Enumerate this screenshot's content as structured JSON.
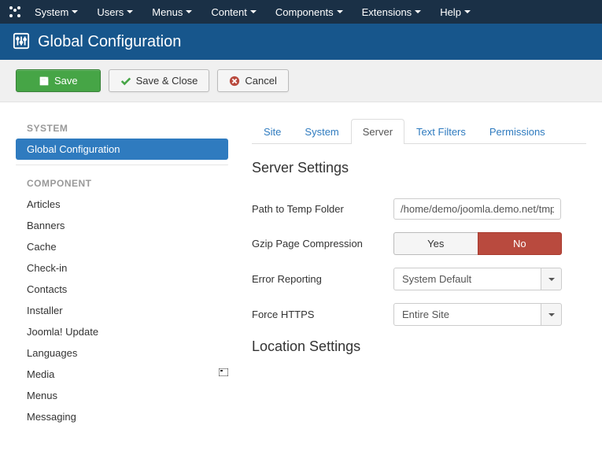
{
  "topnav": {
    "items": [
      "System",
      "Users",
      "Menus",
      "Content",
      "Components",
      "Extensions",
      "Help"
    ]
  },
  "header": {
    "title": "Global Configuration"
  },
  "toolbar": {
    "save": "Save",
    "save_close": "Save & Close",
    "cancel": "Cancel"
  },
  "sidebar": {
    "system_heading": "SYSTEM",
    "system_items": [
      "Global Configuration"
    ],
    "component_heading": "COMPONENT",
    "component_items": [
      "Articles",
      "Banners",
      "Cache",
      "Check-in",
      "Contacts",
      "Installer",
      "Joomla! Update",
      "Languages",
      "Media",
      "Menus",
      "Messaging"
    ]
  },
  "tabs": [
    "Site",
    "System",
    "Server",
    "Text Filters",
    "Permissions"
  ],
  "section1": "Server Settings",
  "section2": "Location Settings",
  "fields": {
    "tmp_label": "Path to Temp Folder",
    "tmp_value": "/home/demo/joomla.demo.net/tmp",
    "gzip_label": "Gzip Page Compression",
    "gzip_yes": "Yes",
    "gzip_no": "No",
    "error_label": "Error Reporting",
    "error_value": "System Default",
    "https_label": "Force HTTPS",
    "https_value": "Entire Site"
  }
}
